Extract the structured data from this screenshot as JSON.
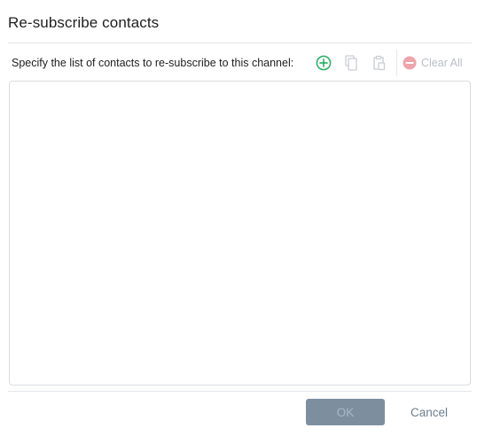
{
  "dialog": {
    "title": "Re-subscribe contacts",
    "instruction": "Specify the list of contacts to re-subscribe to this channel:"
  },
  "toolbar": {
    "add_icon": "add-circle-icon",
    "copy_icon": "copy-icon",
    "paste_icon": "paste-icon",
    "clear_icon": "remove-circle-icon",
    "clear_all_label": "Clear All",
    "colors": {
      "add": "#2fb26a",
      "disabled": "#c9cdd2",
      "clear": "#f0a3a8"
    }
  },
  "contacts_list": {
    "items": []
  },
  "footer": {
    "ok_label": "OK",
    "cancel_label": "Cancel",
    "ok_color": "#7d8f9f",
    "cancel_color": "#6d7e8d"
  }
}
